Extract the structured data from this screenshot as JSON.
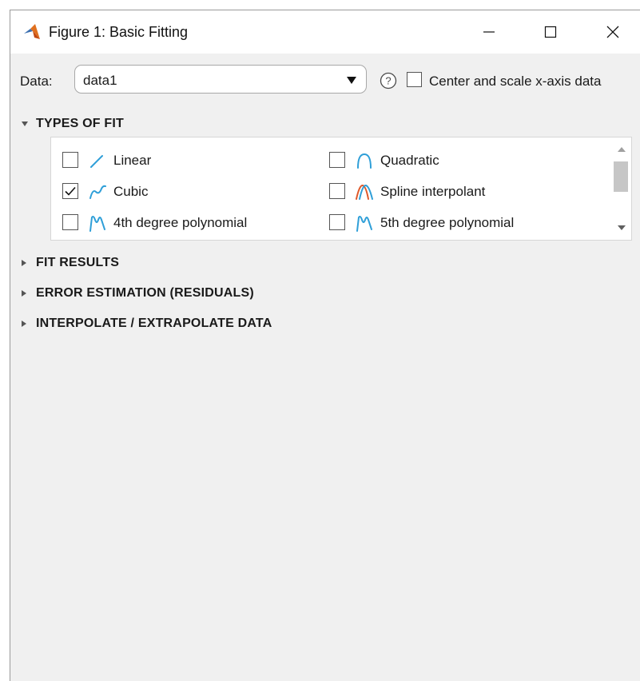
{
  "window": {
    "title": "Figure 1: Basic Fitting",
    "icon": "matlab-logo-icon",
    "controls": [
      "minimize-icon",
      "maximize-icon",
      "close-icon"
    ]
  },
  "data_row": {
    "label": "Data:",
    "selected": "data1",
    "help_icon": "question-icon",
    "center_scale_label": "Center and scale x-axis data",
    "center_scale_checked": false
  },
  "types_of_fit": {
    "title": "TYPES OF FIT",
    "expanded": true,
    "items": [
      {
        "label": "Linear",
        "checked": false,
        "icon": "linear-fit-icon"
      },
      {
        "label": "Quadratic",
        "checked": false,
        "icon": "quadratic-fit-icon"
      },
      {
        "label": "Cubic",
        "checked": true,
        "icon": "cubic-fit-icon"
      },
      {
        "label": "Spline interpolant",
        "checked": false,
        "icon": "spline-fit-icon"
      },
      {
        "label": "4th degree polynomial",
        "checked": false,
        "icon": "poly4-fit-icon"
      },
      {
        "label": "5th degree polynomial",
        "checked": false,
        "icon": "poly5-fit-icon"
      }
    ]
  },
  "sections": [
    {
      "title": "FIT RESULTS",
      "expanded": false
    },
    {
      "title": "ERROR ESTIMATION (RESIDUALS)",
      "expanded": false
    },
    {
      "title": "INTERPOLATE / EXTRAPOLATE DATA",
      "expanded": false
    }
  ],
  "colors": {
    "fit_blue": "#2f9fd8",
    "spline_orange": "#e0592a",
    "background": "#f0f0f0"
  }
}
